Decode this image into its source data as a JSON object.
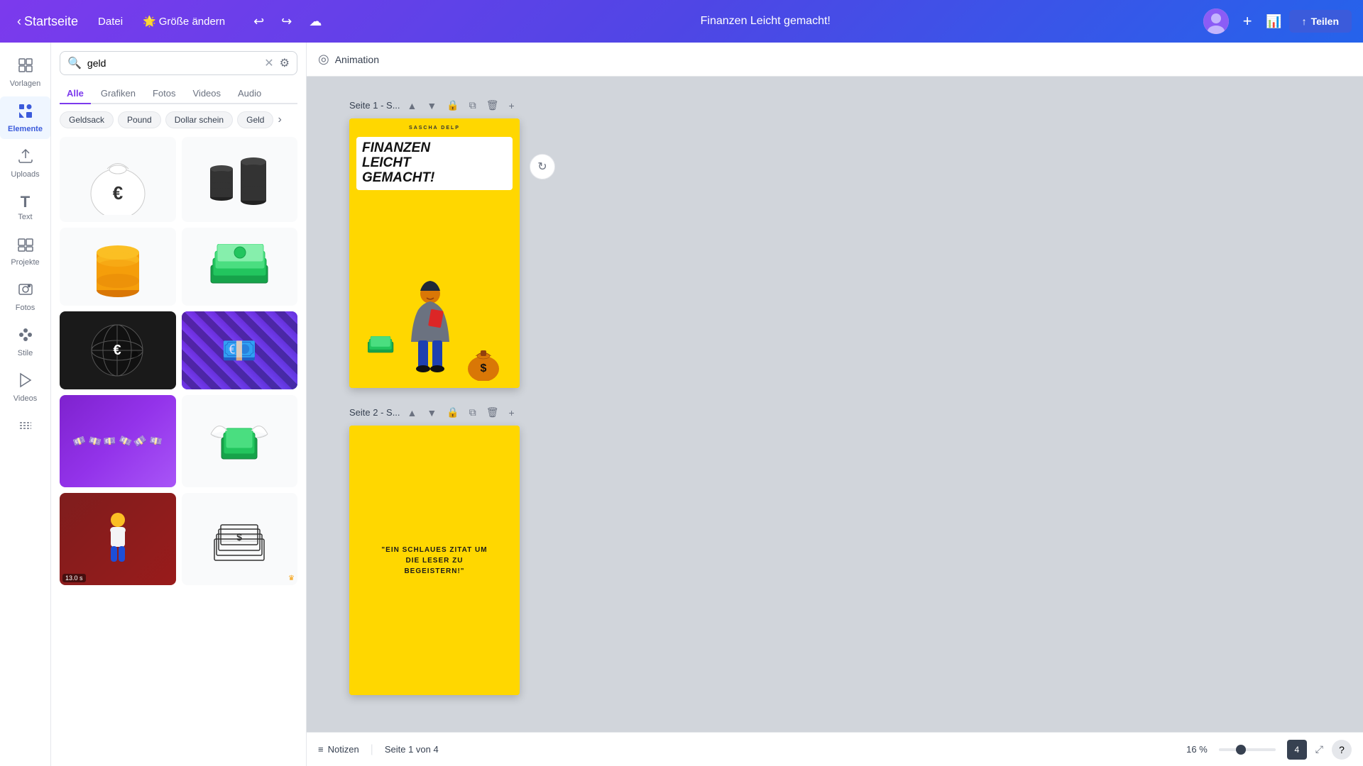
{
  "topbar": {
    "back_label": "Startseite",
    "file_label": "Datei",
    "size_label": "Größe ändern",
    "size_emoji": "🌟",
    "undo_icon": "↩",
    "redo_icon": "↪",
    "cloud_icon": "☁",
    "project_title": "Finanzen Leicht gemacht!",
    "share_label": "Teilen",
    "share_icon": "↑"
  },
  "sidebar": {
    "items": [
      {
        "id": "vorlagen",
        "icon": "⊞",
        "label": "Vorlagen"
      },
      {
        "id": "elemente",
        "icon": "✦",
        "label": "Elemente",
        "active": true
      },
      {
        "id": "uploads",
        "icon": "⬆",
        "label": "Uploads"
      },
      {
        "id": "text",
        "icon": "T",
        "label": "Text"
      },
      {
        "id": "projekte",
        "icon": "▦",
        "label": "Projekte"
      },
      {
        "id": "fotos",
        "icon": "🖼",
        "label": "Fotos"
      },
      {
        "id": "stile",
        "icon": "✱",
        "label": "Stile"
      },
      {
        "id": "videos",
        "icon": "▶",
        "label": "Videos"
      },
      {
        "id": "pattern",
        "icon": "░",
        "label": ""
      }
    ]
  },
  "search_panel": {
    "search_value": "geld",
    "search_placeholder": "geld",
    "tabs": [
      {
        "id": "alle",
        "label": "Alle",
        "active": true
      },
      {
        "id": "grafiken",
        "label": "Grafiken"
      },
      {
        "id": "fotos",
        "label": "Fotos"
      },
      {
        "id": "videos",
        "label": "Videos"
      },
      {
        "id": "audio",
        "label": "Audio"
      }
    ],
    "tag_pills": [
      {
        "id": "geldsack",
        "label": "Geldsack"
      },
      {
        "id": "pound",
        "label": "Pound"
      },
      {
        "id": "dollar_schein",
        "label": "Dollar schein"
      },
      {
        "id": "geld_more",
        "label": "Geld"
      }
    ],
    "results": [
      {
        "id": "euro-bag",
        "type": "svg",
        "description": "Euro money bag white",
        "emoji": "💰"
      },
      {
        "id": "coin-stack",
        "type": "svg",
        "description": "Black coin stacks",
        "emoji": "🪙"
      },
      {
        "id": "gold-coins",
        "type": "svg",
        "description": "Gold coin stack",
        "emoji": "💛"
      },
      {
        "id": "green-cash",
        "type": "svg",
        "description": "Green dollar bills stack",
        "emoji": "💵"
      },
      {
        "id": "euro-globe",
        "type": "svg",
        "description": "Euro globe white black",
        "emoji": "🌐"
      },
      {
        "id": "cash-spread",
        "type": "photo",
        "description": "Euro notes spread photo",
        "emoji": "💶"
      },
      {
        "id": "bills-spread",
        "type": "photo",
        "description": "Purple euro notes spread",
        "emoji": "💷",
        "wide": true
      },
      {
        "id": "flying-money",
        "type": "svg",
        "description": "Flying money with wings",
        "emoji": "🤑"
      },
      {
        "id": "video-woman",
        "type": "video",
        "description": "Woman counting money video",
        "emoji": "👩",
        "duration": "13.0 s"
      },
      {
        "id": "cash-sketch",
        "type": "svg",
        "description": "Sketch style cash stack",
        "emoji": "💴",
        "premium": true
      }
    ]
  },
  "animation_bar": {
    "icon": "◎",
    "label": "Animation"
  },
  "pages": [
    {
      "id": "page1",
      "label": "Seite 1",
      "label_short": "Seite 1 - S...",
      "slide": {
        "author": "SASCHA DELP",
        "title_line1": "FINANZEN",
        "title_line2": "LEICHT",
        "title_line3": "GEMACHT!"
      }
    },
    {
      "id": "page2",
      "label": "Seite 2",
      "label_short": "Seite 2 - S...",
      "slide": {
        "quote": "\"EIN SCHLAUES ZITAT UM DIE LESER ZU BEGEISTERN!\""
      }
    }
  ],
  "statusbar": {
    "notes_icon": "≡",
    "notes_label": "Notizen",
    "page_current": "Seite 1 von 4",
    "zoom_percent": "16 %",
    "expand_icon": "⤢",
    "help_icon": "?"
  }
}
